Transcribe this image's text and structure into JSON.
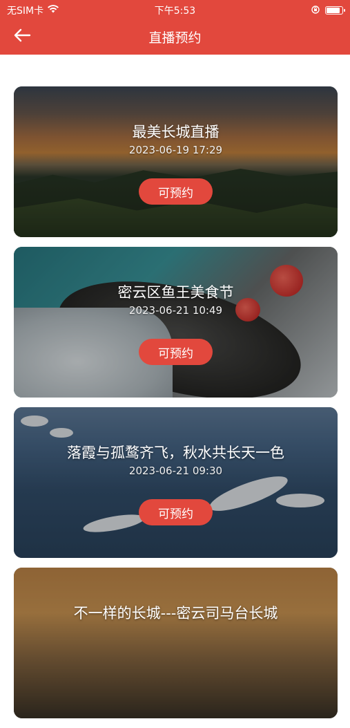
{
  "status_bar": {
    "carrier": "无SIM卡",
    "time": "下午5:53",
    "battery_level": 0.95
  },
  "nav": {
    "title": "直播预约"
  },
  "cards": [
    {
      "title": "最美长城直播",
      "time": "2023-06-19 17:29",
      "button": "可预约"
    },
    {
      "title": "密云区鱼王美食节",
      "time": "2023-06-21 10:49",
      "button": "可预约"
    },
    {
      "title": "落霞与孤鹜齐飞，秋水共长天一色",
      "time": "2023-06-21 09:30",
      "button": "可预约"
    },
    {
      "title": "不一样的长城---密云司马台长城",
      "time": "",
      "button": ""
    }
  ],
  "colors": {
    "brand_red": "#e2483d",
    "background": "#ffffff"
  },
  "icons": [
    "wifi-icon",
    "back-arrow-icon",
    "orientation-lock-icon",
    "battery-icon"
  ]
}
